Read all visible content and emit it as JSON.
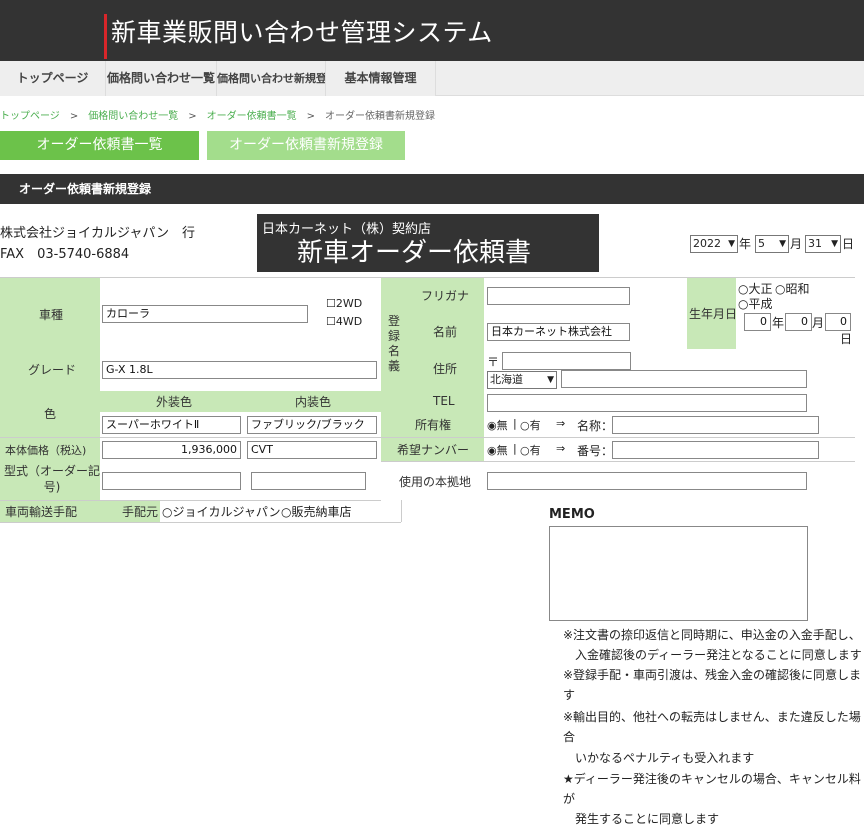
{
  "header": {
    "title": "新車業販問い合わせ管理システム"
  },
  "nav": {
    "items": [
      "トップページ",
      "価格問い合わせ一覧",
      "価格問い合わせ新規登録",
      "基本情報管理"
    ]
  },
  "breadcrumb": {
    "items": [
      "トップページ",
      "価格問い合わせ一覧",
      "オーダー依頼書一覧",
      "オーダー依頼書新規登録"
    ],
    "sep": ">"
  },
  "buttons": {
    "order_list": "オーダー依頼書一覧",
    "order_new": "オーダー依頼書新規登録"
  },
  "section": {
    "title": "オーダー依頼書新規登録"
  },
  "recipient": {
    "company": "株式会社ジョイカルジャパン　行",
    "fax": "FAX　03-5740-6884"
  },
  "banner": {
    "sub": "日本カーネット（株）契約店",
    "main": "新車オーダー依頼書"
  },
  "date": {
    "year": "2022",
    "year_unit": "年",
    "month": "5",
    "month_unit": "月",
    "day": "31",
    "day_unit": "日"
  },
  "form": {
    "model_label": "車種",
    "model_value": "カローラ",
    "drive_2wd": "2WD",
    "drive_4wd": "4WD",
    "grade_label": "グレード",
    "grade_value": "G-X 1.8L",
    "color_label": "色",
    "ext_color_label": "外装色",
    "int_color_label": "内装色",
    "ext_color_value": "スーパーホワイトⅡ",
    "int_color_value": "ファブリック/ブラック",
    "price_label": "本体価格（税込)",
    "price_value": "1,936,000",
    "transmission_value": "CVT",
    "type_label": "型式（オーダー記号)",
    "transport_label": "車両輸送手配",
    "arranger_label": "手配元",
    "arranger_opt1": "ジョイカルジャパン",
    "arranger_opt2": "販売納車店",
    "reg_name_label": "登録名義",
    "furigana_label": "フリガナ",
    "furigana_value": "",
    "name_label": "名前",
    "name_value": "日本カーネット株式会社",
    "address_label": "住所",
    "postal_mark": "〒",
    "prefecture": "北海道",
    "tel_label": "TEL",
    "birth_label": "生年月日",
    "era_taisho": "大正",
    "era_showa": "昭和",
    "era_heisei": "平成",
    "birth_year": "0",
    "birth_year_unit": "年",
    "birth_month": "0",
    "birth_month_unit": "月",
    "birth_day": "0",
    "birth_day_unit": "日",
    "ownership_label": "所有権",
    "ownership_no": "無",
    "ownership_yes": "有",
    "ownership_name_label": "名称：",
    "plate_label": "希望ナンバー",
    "plate_no": "無",
    "plate_yes": "有",
    "plate_number_label": "番号：",
    "base_label": "使用の本拠地",
    "arrow": "⇒",
    "pipe": "|"
  },
  "memo": {
    "label": "MEMO",
    "notes": [
      "※注文書の捺印返信と同時期に、申込金の入金手配し、",
      "　入金確認後のディーラー発注となることに同意します",
      "※登録手配・車両引渡は、残金入金の確認後に同意しま",
      "す",
      "※輸出目的、他社への転売はしません、また違反した場",
      "合",
      "　いかなるペナルティも受入れます",
      "★ディーラー発注後のキャンセルの場合、キャンセル料",
      "が",
      "　発生することに同意します"
    ]
  }
}
